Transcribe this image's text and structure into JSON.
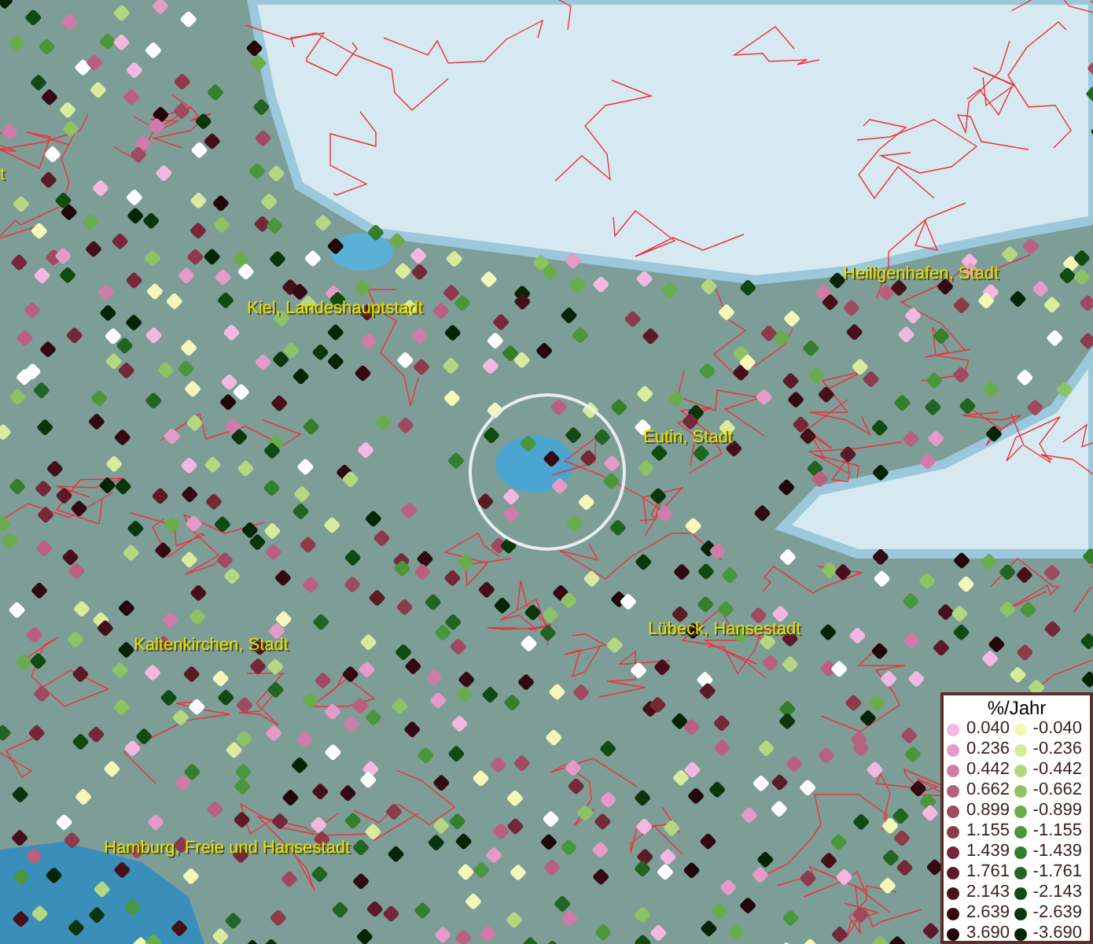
{
  "map": {
    "place_labels": [
      "t",
      "Kiel, Landeshauptstadt",
      "Heiligenhafen, Stadt",
      "Eutin, Stadt",
      "Lübeck, Hansestadt",
      "Kaltenkirchen, Stadt",
      "Hamburg, Freie und Hansestadt"
    ]
  },
  "legend": {
    "title": "%/Jahr",
    "rows": [
      {
        "positive": {
          "value": "0.040",
          "color": "#f4b8e0"
        },
        "negative": {
          "value": "-0.040",
          "color": "#f4f7b8"
        }
      },
      {
        "positive": {
          "value": "0.236",
          "color": "#e59ac8"
        },
        "negative": {
          "value": "-0.236",
          "color": "#d8ec9c"
        }
      },
      {
        "positive": {
          "value": "0.442",
          "color": "#d07ca8"
        },
        "negative": {
          "value": "-0.442",
          "color": "#b4d880"
        }
      },
      {
        "positive": {
          "value": "0.662",
          "color": "#b8607e"
        },
        "negative": {
          "value": "-0.662",
          "color": "#8cc464"
        }
      },
      {
        "positive": {
          "value": "0.899",
          "color": "#a04a62"
        },
        "negative": {
          "value": "-0.899",
          "color": "#6aac4c"
        }
      },
      {
        "positive": {
          "value": "1.155",
          "color": "#8c3a4c"
        },
        "negative": {
          "value": "-1.155",
          "color": "#4a963a"
        }
      },
      {
        "positive": {
          "value": "1.439",
          "color": "#74283a"
        },
        "negative": {
          "value": "-1.439",
          "color": "#347e2c"
        }
      },
      {
        "positive": {
          "value": "1.761",
          "color": "#5c1a28"
        },
        "negative": {
          "value": "-1.761",
          "color": "#226422"
        }
      },
      {
        "positive": {
          "value": "2.143",
          "color": "#46101a"
        },
        "negative": {
          "value": "-2.143",
          "color": "#124a14"
        }
      },
      {
        "positive": {
          "value": "2.639",
          "color": "#340a12"
        },
        "negative": {
          "value": "-2.639",
          "color": "#0a360c"
        }
      },
      {
        "positive": {
          "value": "3.690",
          "color": "#22060a"
        },
        "negative": {
          "value": "-3.690",
          "color": "#062406"
        }
      }
    ]
  }
}
